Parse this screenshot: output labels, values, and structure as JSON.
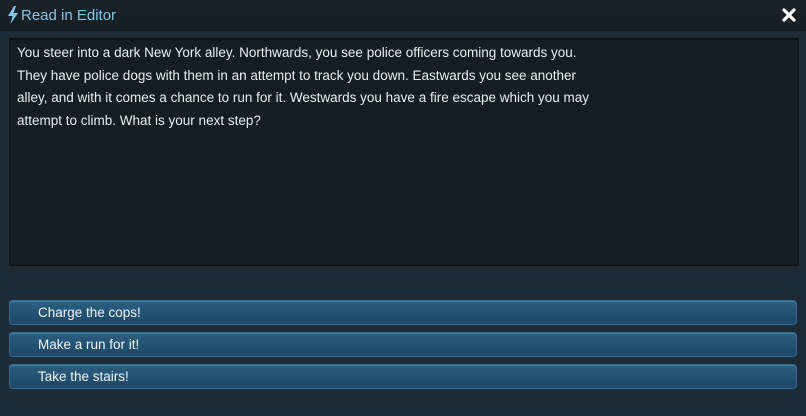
{
  "window": {
    "title": "Read in Editor",
    "title_icon": "lightning-bolt-icon",
    "close_icon": "close-x-icon"
  },
  "story": {
    "lines": [
      "You steer into a dark New York alley. Northwards, you see police officers coming towards you.",
      "They have police dogs with them in an attempt to track you down. Eastwards you see another",
      "alley, and with it comes a chance to run for it. Westwards you have a fire escape which you may",
      "attempt to climb. What is your next step?"
    ]
  },
  "choices": [
    {
      "label": "Charge the cops!"
    },
    {
      "label": "Make a run for it!"
    },
    {
      "label": "Take the stairs!"
    }
  ],
  "colors": {
    "title_accent": "#7fc4ea",
    "choice_button": "#2d5f7f",
    "background": "#1f2b34",
    "story_panel": "#151d22"
  }
}
